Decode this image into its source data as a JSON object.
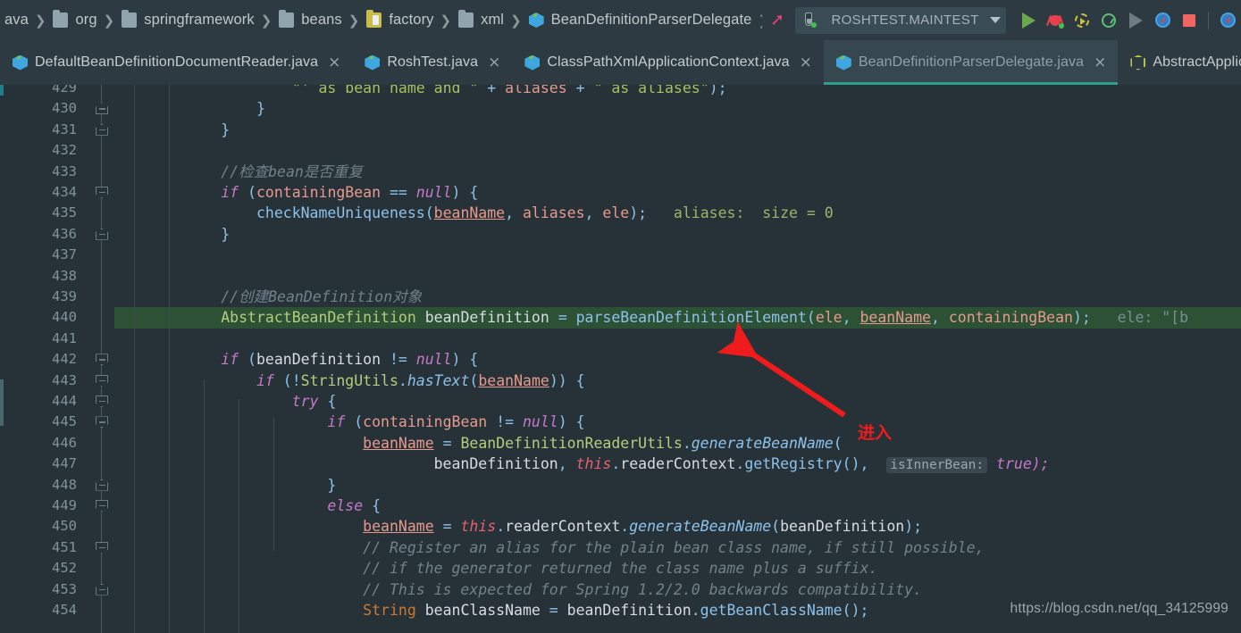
{
  "breadcrumb": {
    "items": [
      {
        "label": "ava",
        "icon": "none"
      },
      {
        "label": "org",
        "icon": "folder-icon"
      },
      {
        "label": "springframework",
        "icon": "folder-icon"
      },
      {
        "label": "beans",
        "icon": "folder-icon"
      },
      {
        "label": "factory",
        "icon": "resource-folder-icon"
      },
      {
        "label": "xml",
        "icon": "folder-icon"
      },
      {
        "label": "BeanDefinitionParserDelegate",
        "icon": "java-class-icon"
      }
    ],
    "separator": "❯"
  },
  "toolbar": {
    "build_icon": "hammer-icon",
    "run_config": {
      "name": "ROSHTEST.MAINTEST",
      "icon": "test-flask-icon",
      "dropdown_icon": "chevron-down-icon"
    },
    "buttons": [
      {
        "name": "run-button",
        "icon": "run-triangle-icon"
      },
      {
        "name": "debug-button",
        "icon": "debug-bug-icon"
      },
      {
        "name": "run-with-coverage-button",
        "icon": "coverage-ring-icon"
      },
      {
        "name": "profile-button",
        "icon": "profiler-gauge-icon"
      },
      {
        "name": "run-disabled-button",
        "icon": "run-triangle-grey-icon"
      },
      {
        "name": "attach-debugger-button",
        "icon": "blue-debug-circle-icon"
      },
      {
        "name": "stop-button",
        "icon": "stop-square-icon"
      },
      {
        "name": "extra-debug-button",
        "icon": "blue-debug-circle-icon"
      }
    ]
  },
  "tabs": [
    {
      "label": "DefaultBeanDefinitionDocumentReader.java",
      "icon": "java-class-icon",
      "active": false,
      "close_icon": "×"
    },
    {
      "label": "RoshTest.java",
      "icon": "java-class-icon",
      "active": false,
      "close_icon": "×"
    },
    {
      "label": "ClassPathXmlApplicationContext.java",
      "icon": "java-class-icon",
      "active": false,
      "close_icon": "×"
    },
    {
      "label": "BeanDefinitionParserDelegate.java",
      "icon": "java-class-icon",
      "active": true,
      "close_icon": "×"
    },
    {
      "label": "AbstractApplicationCo",
      "icon": "abstract-class-icon",
      "active": false,
      "close_icon": ""
    }
  ],
  "editor": {
    "first_line": 429,
    "execution_line": 440,
    "watermark": "https://blog.csdn.net/qq_34125999",
    "annotation": {
      "text": "进入",
      "color": "#ee1c1c"
    },
    "lines": [
      {
        "n": 429,
        "fold": null
      },
      {
        "n": 430,
        "fold": "up"
      },
      {
        "n": 431,
        "fold": "up"
      },
      {
        "n": 432,
        "fold": null
      },
      {
        "n": 433,
        "fold": null
      },
      {
        "n": 434,
        "fold": "dn"
      },
      {
        "n": 435,
        "fold": null
      },
      {
        "n": 436,
        "fold": "up"
      },
      {
        "n": 437,
        "fold": null
      },
      {
        "n": 438,
        "fold": null
      },
      {
        "n": 439,
        "fold": null
      },
      {
        "n": 440,
        "fold": null
      },
      {
        "n": 441,
        "fold": null
      },
      {
        "n": 442,
        "fold": "dn"
      },
      {
        "n": 443,
        "fold": "dn"
      },
      {
        "n": 444,
        "fold": "dn"
      },
      {
        "n": 445,
        "fold": "dn"
      },
      {
        "n": 446,
        "fold": null
      },
      {
        "n": 447,
        "fold": null
      },
      {
        "n": 448,
        "fold": "up"
      },
      {
        "n": 449,
        "fold": "dn"
      },
      {
        "n": 450,
        "fold": null
      },
      {
        "n": 451,
        "fold": "dn"
      },
      {
        "n": 452,
        "fold": null
      },
      {
        "n": 453,
        "fold": "up"
      },
      {
        "n": 454,
        "fold": null
      }
    ],
    "source_text": [
      "                    \"' as bean name and \" + aliases + \" as aliases\");",
      "                }",
      "            }",
      "",
      "            //检查bean是否重复",
      "            if (containingBean == null) {",
      "                checkNameUniqueness(beanName, aliases, ele);   aliases:  size = 0",
      "            }",
      "",
      "",
      "            //创建BeanDefinition对象",
      "            AbstractBeanDefinition beanDefinition = parseBeanDefinitionElement(ele, beanName, containingBean);   ele: \"[b",
      "",
      "            if (beanDefinition != null) {",
      "                if (!StringUtils.hasText(beanName)) {",
      "                    try {",
      "                        if (containingBean != null) {",
      "                            beanName = BeanDefinitionReaderUtils.generateBeanName(",
      "                                    beanDefinition, this.readerContext.getRegistry(),  isInnerBean: true);",
      "                        }",
      "                        else {",
      "                            beanName = this.readerContext.generateBeanName(beanDefinition);",
      "                            // Register an alias for the plain bean class name, if still possible,",
      "                            // if the generator returned the class name plus a suffix.",
      "                            // This is expected for Spring 1.2/2.0 backwards compatibility.",
      "                            String beanClassName = beanDefinition.getBeanClassName();"
    ],
    "inline_hints": [
      {
        "line": 435,
        "text": "aliases:  size = 0"
      },
      {
        "line": 440,
        "text": "ele: \"[b"
      },
      {
        "line": 447,
        "text": "isInnerBean:"
      }
    ]
  },
  "colors": {
    "editor_bg": "#263238",
    "chrome_bg": "#2e3a41",
    "active_tab_bg": "#37474f",
    "active_tab_underline": "#2f9e8f",
    "exec_line_bg": "#2c5134",
    "annotation_red": "#ee1c1c",
    "keyword": "#cc7832",
    "string": "#a5c261",
    "comment": "#72818a",
    "method": "#8dc1ea",
    "field": "#e8998d",
    "this_keyword": "#e8606f"
  }
}
